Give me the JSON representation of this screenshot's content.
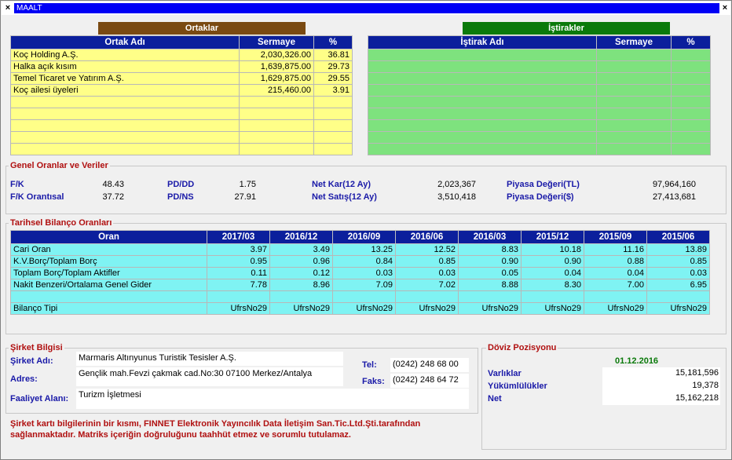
{
  "window": {
    "title": "MAALT"
  },
  "ortaklar": {
    "header": "Ortaklar",
    "columns": [
      "Ortak Adı",
      "Sermaye",
      "%"
    ],
    "rows": [
      [
        "Koç Holding A.Ş.",
        "2,030,326.00",
        "36.81"
      ],
      [
        "Halka açık kısım",
        "1,639,875.00",
        "29.73"
      ],
      [
        "Temel Ticaret ve Yatırım A.Ş.",
        "1,629,875.00",
        "29.55"
      ],
      [
        "Koç ailesi üyeleri",
        "215,460.00",
        "3.91"
      ],
      [
        "",
        "",
        ""
      ],
      [
        "",
        "",
        ""
      ],
      [
        "",
        "",
        ""
      ],
      [
        "",
        "",
        ""
      ],
      [
        "",
        "",
        ""
      ]
    ]
  },
  "istirakler": {
    "header": "İştirakler",
    "columns": [
      "İştirak Adı",
      "Sermaye",
      "%"
    ],
    "rows": [
      [
        "",
        "",
        ""
      ],
      [
        "",
        "",
        ""
      ],
      [
        "",
        "",
        ""
      ],
      [
        "",
        "",
        ""
      ],
      [
        "",
        "",
        ""
      ],
      [
        "",
        "",
        ""
      ],
      [
        "",
        "",
        ""
      ],
      [
        "",
        "",
        ""
      ],
      [
        "",
        "",
        ""
      ]
    ]
  },
  "genel": {
    "title": "Genel Oranlar ve Veriler",
    "fk_label": "F/K",
    "fk_value": "48.43",
    "fko_label": "F/K Orantısal",
    "fko_value": "37.72",
    "pddd_label": "PD/DD",
    "pddd_value": "1.75",
    "pdns_label": "PD/NS",
    "pdns_value": "27.91",
    "netkar_label": "Net Kar(12 Ay)",
    "netkar_value": "2,023,367",
    "netsatis_label": "Net Satış(12 Ay)",
    "netsatis_value": "3,510,418",
    "pdtl_label": "Piyasa Değeri(TL)",
    "pdtl_value": "97,964,160",
    "pdusd_label": "Piyasa Değeri($)",
    "pdusd_value": "27,413,681"
  },
  "tarihsel": {
    "title": "Tarihsel Bilanço Oranları",
    "columns": [
      "Oran",
      "2017/03",
      "2016/12",
      "2016/09",
      "2016/06",
      "2016/03",
      "2015/12",
      "2015/09",
      "2015/06"
    ],
    "rows": [
      [
        "Cari Oran",
        "3.97",
        "3.49",
        "13.25",
        "12.52",
        "8.83",
        "10.18",
        "11.16",
        "13.89"
      ],
      [
        "K.V.Borç/Toplam Borç",
        "0.95",
        "0.96",
        "0.84",
        "0.85",
        "0.90",
        "0.90",
        "0.88",
        "0.85"
      ],
      [
        "Toplam Borç/Toplam Aktifler",
        "0.11",
        "0.12",
        "0.03",
        "0.03",
        "0.05",
        "0.04",
        "0.04",
        "0.03"
      ],
      [
        "Nakit Benzeri/Ortalama Genel Gider",
        "7.78",
        "8.96",
        "7.09",
        "7.02",
        "8.88",
        "8.30",
        "7.00",
        "6.95"
      ],
      [
        "",
        "",
        "",
        "",
        "",
        "",
        "",
        "",
        ""
      ],
      [
        "Bilanço Tipi",
        "UfrsNo29",
        "UfrsNo29",
        "UfrsNo29",
        "UfrsNo29",
        "UfrsNo29",
        "UfrsNo29",
        "UfrsNo29",
        "UfrsNo29"
      ]
    ]
  },
  "sirket": {
    "title": "Şirket Bilgisi",
    "adi_label": "Şirket Adı:",
    "adi_value": "Marmaris Altınyunus Turistik Tesisler A.Ş.",
    "adres_label": "Adres:",
    "adres_value": "Gençlik mah.Fevzi çakmak cad.No:30 07100 Merkez/Antalya",
    "faaliyet_label": "Faaliyet Alanı:",
    "faaliyet_value": "Turizm İşletmesi",
    "tel_label": "Tel:",
    "tel_value": "(0242) 248 68 00",
    "faks_label": "Faks:",
    "faks_value": "(0242) 248 64 72"
  },
  "doviz": {
    "title": "Döviz Pozisyonu",
    "date": "01.12.2016",
    "varliklar_label": "Varlıklar",
    "varliklar_value": "15,181,596",
    "yukumluluk_label": "Yükümlülükler",
    "yukumluluk_value": "19,378",
    "net_label": "Net",
    "net_value": "15,162,218"
  },
  "disclaimer": "Şirket kartı bilgilerinin bir kısmı, FINNET Elektronik Yayıncılık Data İletişim San.Tic.Ltd.Şti.tarafından sağlanmaktadır. Matriks içeriğin doğruluğunu taahhüt etmez ve sorumlu tutulamaz.",
  "colors": {
    "header_blue": "#0b1f9c",
    "ortaklar_brown": "#7a4a12",
    "istirakler_green": "#0b7a0b",
    "section_red": "#b01010",
    "label_blue": "#1a1aa8"
  }
}
